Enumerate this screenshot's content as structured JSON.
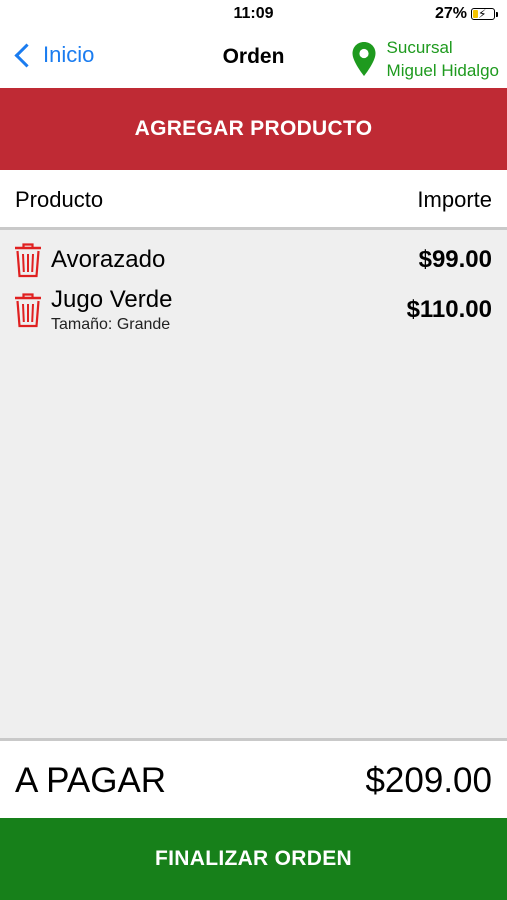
{
  "status_bar": {
    "time": "11:09",
    "battery_percent_label": "27%",
    "battery_level": 0.27,
    "battery_icon": "battery-charging-icon"
  },
  "nav": {
    "back_label": "Inicio",
    "back_icon": "chevron-left-icon",
    "title": "Orden",
    "branch_icon": "location-pin-icon",
    "branch_line1": "Sucursal",
    "branch_line2": "Miguel Hidalgo"
  },
  "actions": {
    "add_product_label": "AGREGAR PRODUCTO",
    "finish_label": "FINALIZAR ORDEN"
  },
  "table": {
    "col_product": "Producto",
    "col_amount": "Importe"
  },
  "items": [
    {
      "name": "Avorazado",
      "detail": "",
      "price": "$99.00",
      "icon": "trash-icon"
    },
    {
      "name": "Jugo Verde",
      "detail": "Tamaño: Grande",
      "price": "$110.00",
      "icon": "trash-icon"
    }
  ],
  "total": {
    "label": "A PAGAR",
    "value": "$209.00"
  },
  "colors": {
    "accent_red": "#bf2a34",
    "accent_green": "#17801a",
    "link_blue": "#1a7cf0",
    "branch_green": "#1e9a1e",
    "trash_red": "#e02020"
  }
}
